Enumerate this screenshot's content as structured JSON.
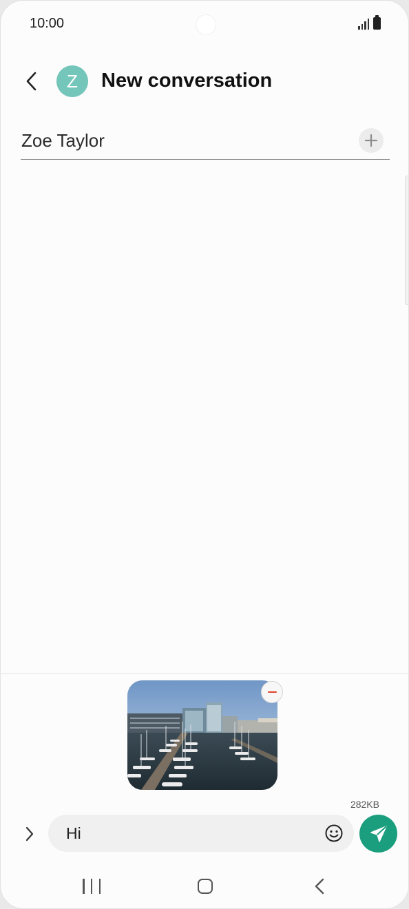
{
  "status_bar": {
    "time": "10:00",
    "icons": [
      "signal-icon",
      "battery-icon"
    ]
  },
  "header": {
    "title": "New conversation",
    "avatar_letter": "Z",
    "back_icon": "back-arrow-icon"
  },
  "recipient": {
    "name": "Zoe Taylor",
    "add_icon": "plus-icon"
  },
  "attachment": {
    "type": "image",
    "size": "282KB",
    "remove_icon": "minus-icon"
  },
  "composer": {
    "message": "Hi",
    "expand_icon": "chevron-right-icon",
    "emoji_icon": "smiley-icon",
    "send_icon": "send-icon"
  },
  "colors": {
    "accent": "#1b9e7e",
    "avatar_bg": "#74c6bb",
    "remove_red": "#e0432b"
  },
  "navigation": {
    "icons": [
      "recent-apps-icon",
      "home-icon",
      "back-icon"
    ]
  }
}
